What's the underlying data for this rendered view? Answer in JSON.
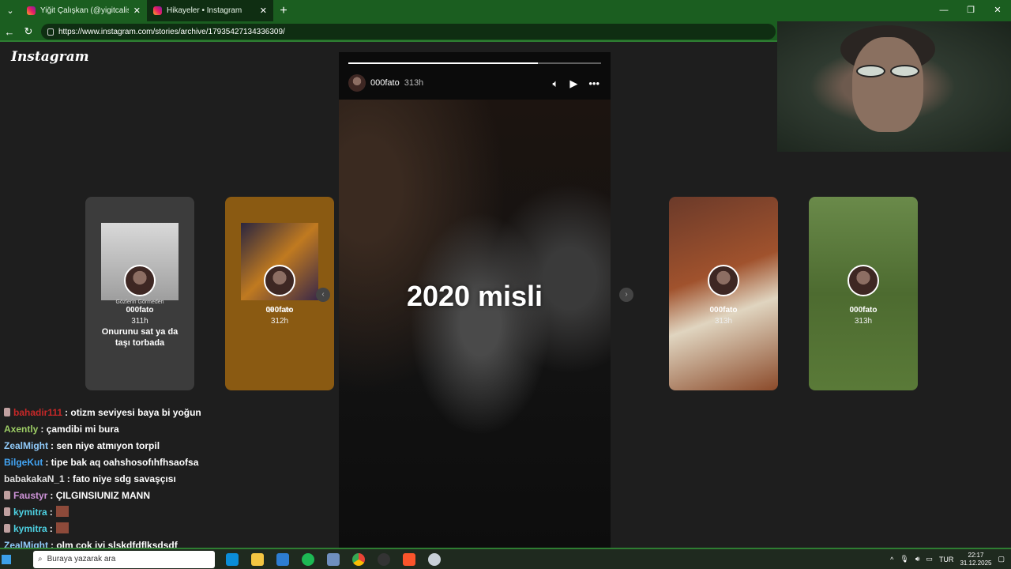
{
  "browser": {
    "tabs": [
      {
        "title": "Yiğit Çalışkan (@yigitcaliskan_) • I"
      },
      {
        "title": "Hikayeler • Instagram"
      }
    ],
    "url": "https://www.instagram.com/stories/archive/17935427134336309/"
  },
  "instagram": {
    "logo": "Instagram",
    "story": {
      "username": "000fato",
      "time": "313h",
      "text": "2020 misli",
      "progress": 0.75
    },
    "cards": [
      {
        "small": "Gözlerin Görmeden",
        "username": "000fato",
        "time": "311h",
        "caption": "Onurunu sat ya da taşı torbada"
      },
      {
        "small": "Şe... ...ler",
        "username": "000fato",
        "time": "312h",
        "caption": ""
      },
      {
        "username": "000fato",
        "time": "313h"
      },
      {
        "username": "000fato",
        "time": "313h"
      }
    ]
  },
  "chat": [
    {
      "user": "bahadir111",
      "color": "#c62828",
      "text": ": otizm seviyesi baya bi yoğun",
      "badge": true,
      "emote": false
    },
    {
      "user": "Axently",
      "color": "#9ccc65",
      "text": ": çamdibi mi bura",
      "badge": false,
      "emote": false
    },
    {
      "user": "ZealMight",
      "color": "#90caf9",
      "text": ": sen niye atmıyon torpil",
      "badge": false,
      "emote": false
    },
    {
      "user": "BilgeKut",
      "color": "#42a5f5",
      "text": ": tipe bak aq oahshosofıhfhsaofsa",
      "badge": false,
      "emote": false
    },
    {
      "user": "babakakaN_1",
      "color": "#e0e0e0",
      "text": ": fato niye sdg savaşçısı",
      "badge": false,
      "emote": false
    },
    {
      "user": "Faustyr",
      "color": "#ce93d8",
      "text": ": ÇILGINSIUNIZ MANN",
      "badge": true,
      "emote": false
    },
    {
      "user": "kymitra",
      "color": "#4dd0e1",
      "text": ":",
      "badge": true,
      "emote": true
    },
    {
      "user": "kymitra",
      "color": "#4dd0e1",
      "text": ":",
      "badge": true,
      "emote": true
    },
    {
      "user": "ZealMight",
      "color": "#90caf9",
      "text": ": olm cok iyi slşkdfdflksdsdf",
      "badge": false,
      "emote": false
    }
  ],
  "taskbar": {
    "search_text": "Buraya yazarak ara",
    "lang": "TUR",
    "time": "22:17",
    "date": "31.12.2025"
  }
}
